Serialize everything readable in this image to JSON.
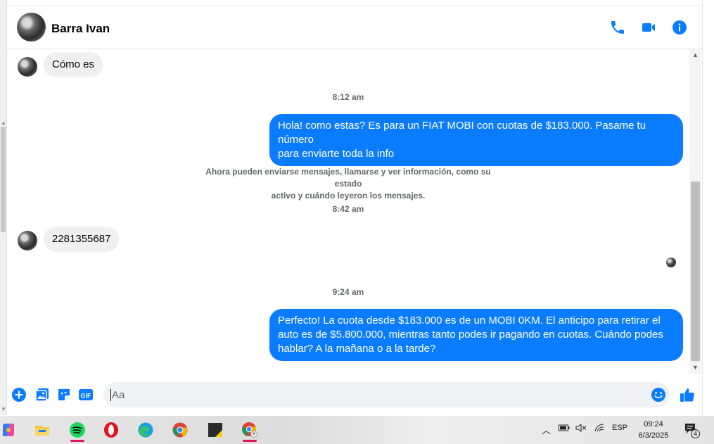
{
  "header": {
    "contact_name": "Barra Ivan",
    "icons": [
      "phone-icon",
      "video-camera-icon",
      "info-icon"
    ],
    "accent_color": "#0a7cff"
  },
  "messages": [
    {
      "direction": "incoming",
      "text": "Cómo es"
    },
    {
      "type": "timestamp",
      "text": "8:12 am"
    },
    {
      "direction": "outgoing",
      "lines": [
        "Hola! como estas? Es para un FIAT MOBI con cuotas de $183.000. Pasame tu número",
        "para enviarte toda la info"
      ]
    },
    {
      "type": "notice",
      "lines": [
        "Ahora pueden enviarse mensajes, llamarse y ver información, como su estado",
        "activo y cuándo leyeron los mensajes."
      ]
    },
    {
      "type": "timestamp",
      "text": "8:42 am"
    },
    {
      "direction": "incoming",
      "text": "2281355687"
    },
    {
      "type": "timestamp",
      "text": "9:24 am"
    },
    {
      "direction": "outgoing",
      "lines": [
        "Perfecto! La cuota desde $183.000 es de un MOBI 0KM. El anticipo para retirar el",
        "auto es de $5.800.000, mientras tanto podes ir pagando en cuotas. Cuándo podes",
        "hablar? A la mañana o a la tarde?"
      ]
    }
  ],
  "composer": {
    "placeholder": "Aa",
    "icons": [
      "plus-icon",
      "gallery-icon",
      "sticker-icon",
      "gif-icon",
      "emoji-icon",
      "like-icon"
    ],
    "gif_label": "GIF"
  },
  "taskbar": {
    "apps": [
      "copilot-icon",
      "file-explorer-icon",
      "spotify-icon",
      "opera-icon",
      "edge-icon",
      "chrome-icon",
      "sticky-notes-icon",
      "chrome-profile-icon"
    ],
    "language": "ESP",
    "time": "09:24",
    "date": "6/3/2025",
    "notification_count": "4"
  }
}
